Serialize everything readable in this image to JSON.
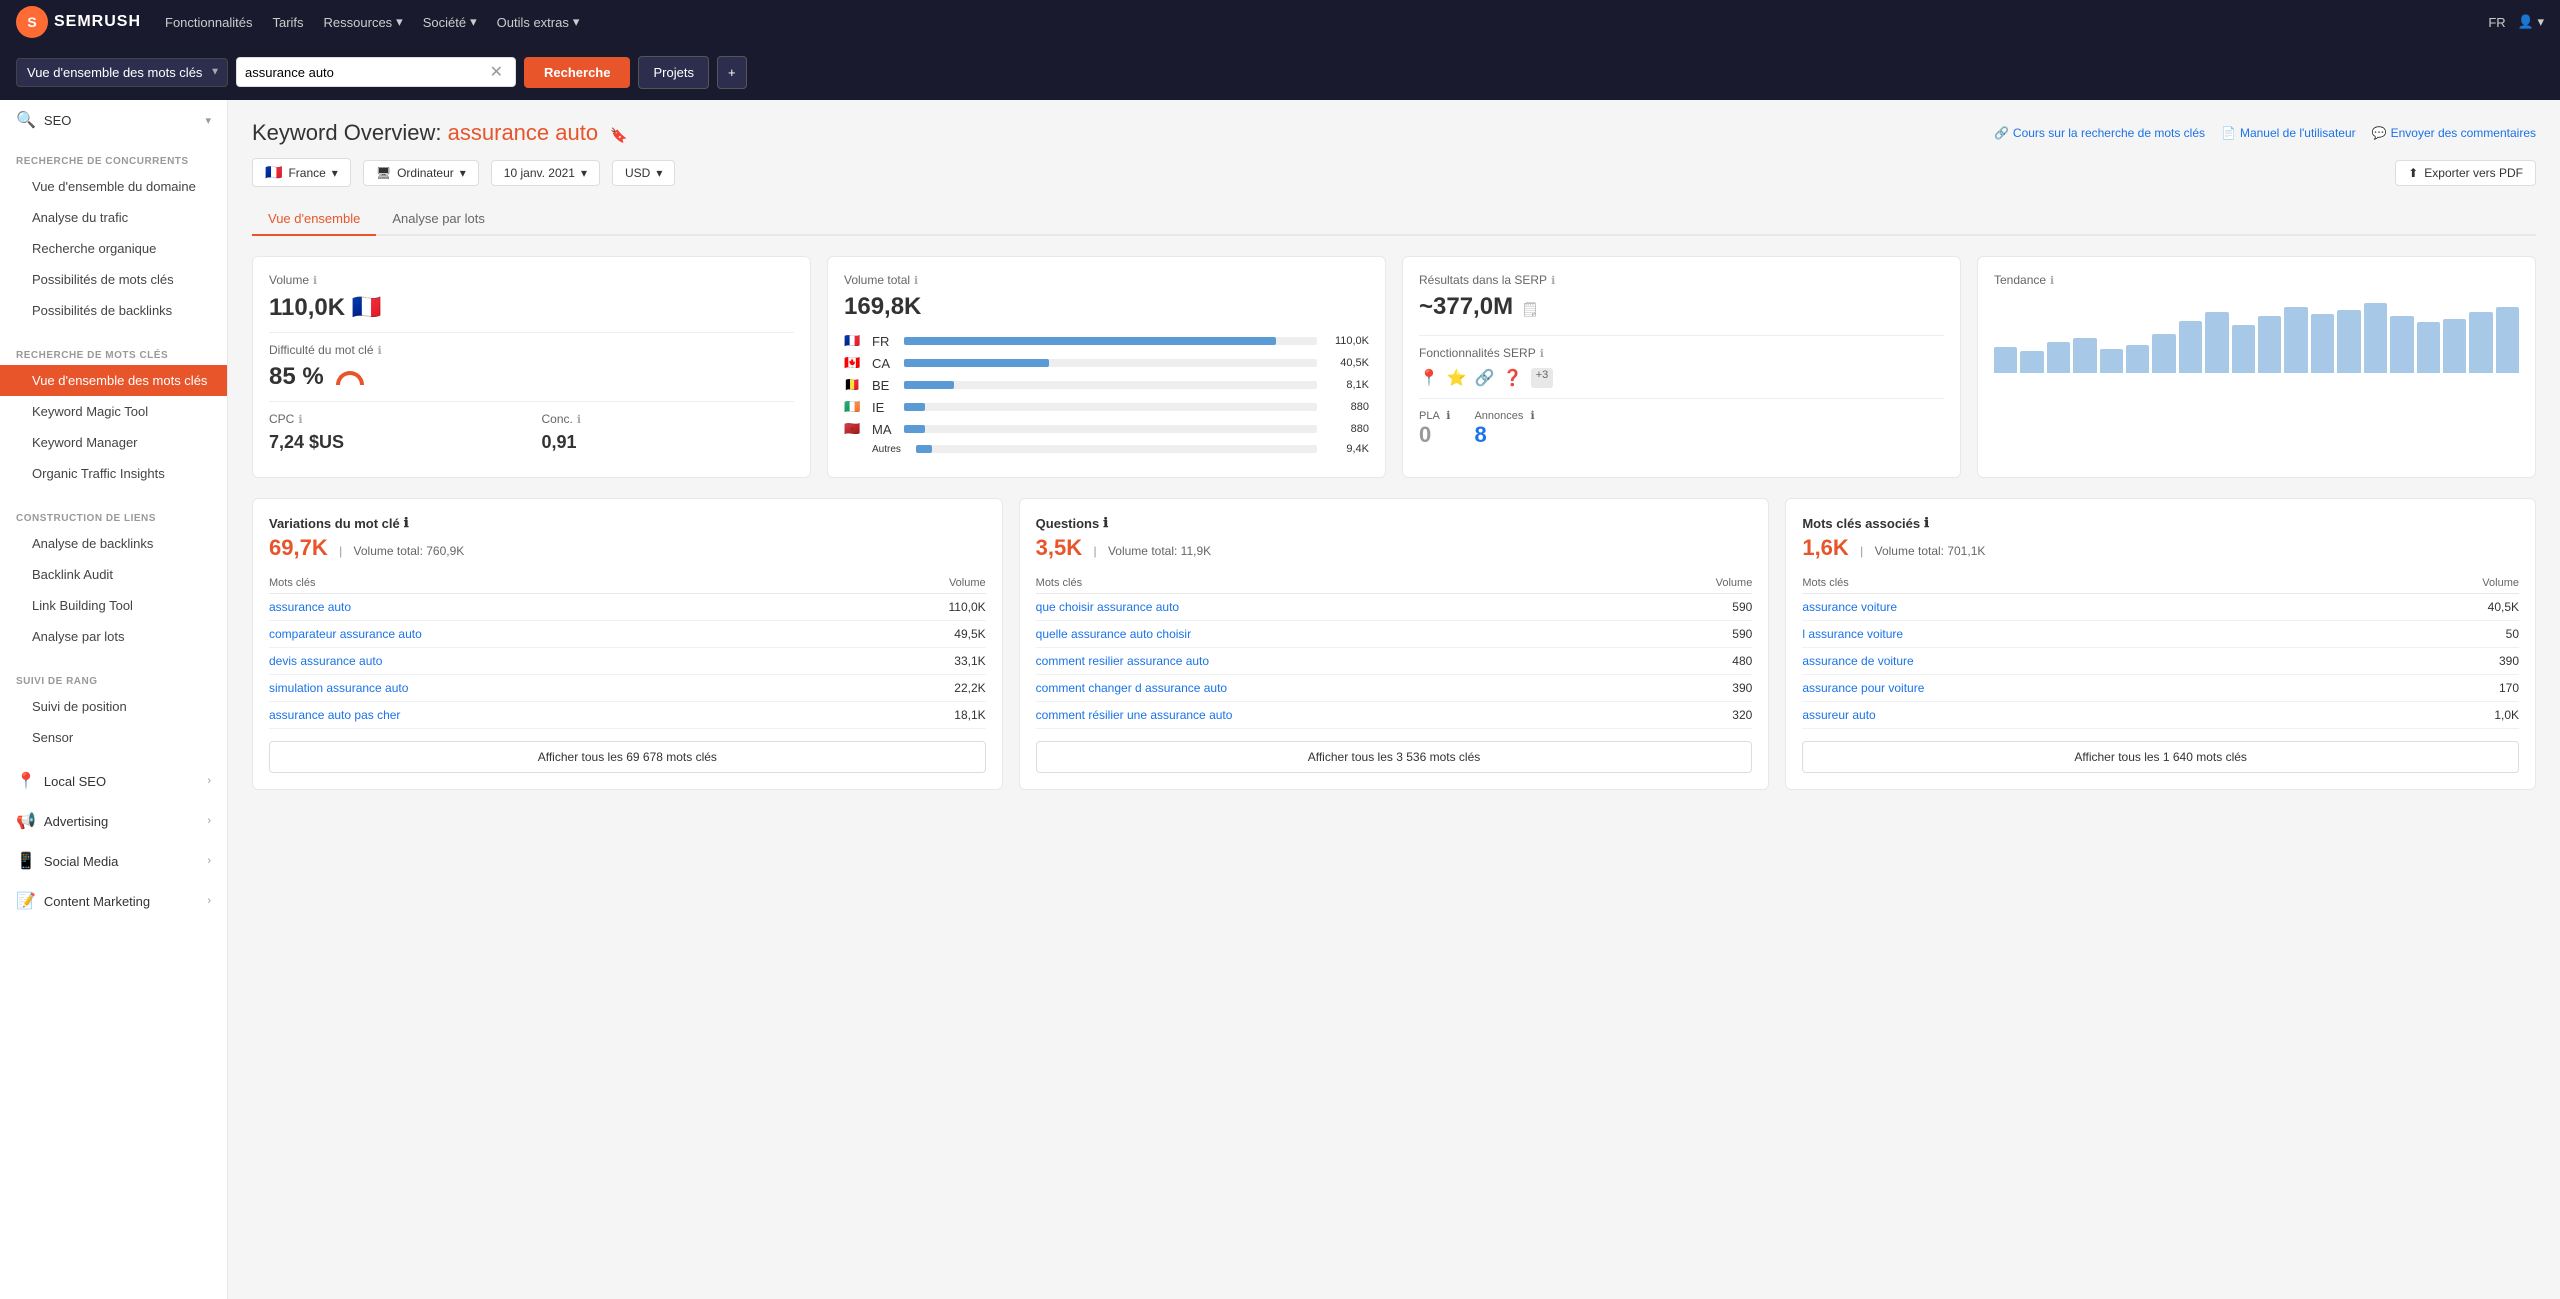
{
  "topNav": {
    "logoText": "SEMRUSH",
    "links": [
      {
        "label": "Fonctionnalités"
      },
      {
        "label": "Tarifs"
      },
      {
        "label": "Ressources",
        "hasArrow": true
      },
      {
        "label": "Société",
        "hasArrow": true
      },
      {
        "label": "Outils extras",
        "hasArrow": true
      }
    ],
    "right": [
      {
        "label": "FR",
        "hasArrow": true
      },
      {
        "label": "👤",
        "hasArrow": true
      }
    ]
  },
  "toolbar": {
    "selectLabel": "Vue d'ensemble des mots clés",
    "searchValue": "assurance auto",
    "searchBtn": "Recherche",
    "projectsBtn": "Projets",
    "plusBtn": "+"
  },
  "sidebar": {
    "seoLabel": "SEO",
    "sections": [
      {
        "title": "RECHERCHE DE CONCURRENTS",
        "items": [
          {
            "label": "Vue d'ensemble du domaine",
            "active": false
          },
          {
            "label": "Analyse du trafic",
            "active": false
          },
          {
            "label": "Recherche organique",
            "active": false
          },
          {
            "label": "Possibilités de mots clés",
            "active": false
          },
          {
            "label": "Possibilités de backlinks",
            "active": false
          }
        ]
      },
      {
        "title": "RECHERCHE DE MOTS CLÉS",
        "items": [
          {
            "label": "Vue d'ensemble des mots clés",
            "active": true
          },
          {
            "label": "Keyword Magic Tool",
            "active": false
          },
          {
            "label": "Keyword Manager",
            "active": false
          },
          {
            "label": "Organic Traffic Insights",
            "active": false
          }
        ]
      },
      {
        "title": "CONSTRUCTION DE LIENS",
        "items": [
          {
            "label": "Analyse de backlinks",
            "active": false
          },
          {
            "label": "Backlink Audit",
            "active": false
          },
          {
            "label": "Link Building Tool",
            "active": false
          },
          {
            "label": "Analyse par lots",
            "active": false
          }
        ]
      },
      {
        "title": "SUIVI DE RANG",
        "items": [
          {
            "label": "Suivi de position",
            "active": false
          },
          {
            "label": "Sensor",
            "active": false
          }
        ]
      }
    ],
    "categories": [
      {
        "icon": "📍",
        "label": "Local SEO"
      },
      {
        "icon": "📢",
        "label": "Advertising"
      },
      {
        "icon": "📱",
        "label": "Social Media"
      },
      {
        "icon": "📝",
        "label": "Content Marketing"
      }
    ]
  },
  "pageHeader": {
    "titlePrefix": "Keyword Overview:",
    "keyword": "assurance auto",
    "links": [
      {
        "icon": "🔗",
        "label": "Cours sur la recherche de mots clés"
      },
      {
        "icon": "📄",
        "label": "Manuel de l'utilisateur"
      },
      {
        "icon": "💬",
        "label": "Envoyer des commentaires"
      }
    ],
    "exportBtn": "Exporter vers PDF"
  },
  "filters": {
    "country": "France",
    "countryFlag": "🇫🇷",
    "device": "Ordinateur",
    "date": "10 janv. 2021",
    "currency": "USD"
  },
  "tabs": [
    {
      "label": "Vue d'ensemble",
      "active": true
    },
    {
      "label": "Analyse par lots",
      "active": false
    }
  ],
  "metrics": {
    "volume": {
      "label": "Volume",
      "value": "110,0K",
      "flag": "🇫🇷"
    },
    "difficulty": {
      "label": "Difficulté du mot clé",
      "value": "85 %"
    },
    "cpc": {
      "label": "CPC",
      "value": "7,24 $US"
    },
    "conc": {
      "label": "Conc.",
      "value": "0,91"
    },
    "volumeTotal": {
      "label": "Volume total",
      "value": "169,8K",
      "breakdown": [
        {
          "flag": "🇫🇷",
          "code": "FR",
          "bar": 90,
          "num": "110,0K"
        },
        {
          "flag": "🇨🇦",
          "code": "CA",
          "bar": 35,
          "num": "40,5K"
        },
        {
          "flag": "🇧🇪",
          "code": "BE",
          "bar": 12,
          "num": "8,1K"
        },
        {
          "flag": "🇮🇪",
          "code": "IE",
          "bar": 5,
          "num": "880"
        },
        {
          "flag": "🇲🇦",
          "code": "MA",
          "bar": 5,
          "num": "880"
        },
        {
          "flag": "",
          "code": "Autres",
          "bar": 4,
          "num": "9,4K"
        }
      ]
    },
    "serp": {
      "label": "Résultats dans la SERP",
      "value": "~377,0M",
      "featuresLabel": "Fonctionnalités SERP",
      "icons": [
        "📍",
        "⭐",
        "🔗",
        "❓"
      ],
      "plus": "+3"
    },
    "pla": {
      "label": "PLA",
      "value": "0"
    },
    "annonces": {
      "label": "Annonces",
      "value": "8"
    },
    "tendance": {
      "label": "Tendance",
      "bars": [
        30,
        25,
        35,
        40,
        28,
        32,
        45,
        60,
        70,
        55,
        65,
        75,
        68,
        72,
        80,
        65,
        58,
        62,
        70,
        75
      ]
    }
  },
  "variations": {
    "title": "Variations du mot clé",
    "count": "69,7K",
    "volumeTotal": "Volume total: 760,9K",
    "showAll": "Afficher tous les 69 678 mots clés",
    "cols": [
      "Mots clés",
      "Volume"
    ],
    "rows": [
      {
        "kw": "assurance auto",
        "vol": "110,0K"
      },
      {
        "kw": "comparateur assurance auto",
        "vol": "49,5K"
      },
      {
        "kw": "devis assurance auto",
        "vol": "33,1K"
      },
      {
        "kw": "simulation assurance auto",
        "vol": "22,2K"
      },
      {
        "kw": "assurance auto pas cher",
        "vol": "18,1K"
      }
    ]
  },
  "questions": {
    "title": "Questions",
    "count": "3,5K",
    "volumeTotal": "Volume total: 11,9K",
    "showAll": "Afficher tous les 3 536 mots clés",
    "cols": [
      "Mots clés",
      "Volume"
    ],
    "rows": [
      {
        "kw": "que choisir assurance auto",
        "vol": "590"
      },
      {
        "kw": "quelle assurance auto choisir",
        "vol": "590"
      },
      {
        "kw": "comment resilier assurance auto",
        "vol": "480"
      },
      {
        "kw": "comment changer d assurance auto",
        "vol": "390"
      },
      {
        "kw": "comment résilier une assurance auto",
        "vol": "320"
      }
    ]
  },
  "associatedKw": {
    "title": "Mots clés associés",
    "count": "1,6K",
    "volumeTotal": "Volume total: 701,1K",
    "showAll": "Afficher tous les 1 640 mots clés",
    "cols": [
      "Mots clés",
      "Volume"
    ],
    "rows": [
      {
        "kw": "assurance voiture",
        "vol": "40,5K"
      },
      {
        "kw": "l assurance voiture",
        "vol": "50"
      },
      {
        "kw": "assurance de voiture",
        "vol": "390"
      },
      {
        "kw": "assurance pour voiture",
        "vol": "170"
      },
      {
        "kw": "assureur auto",
        "vol": "1,0K"
      }
    ]
  }
}
